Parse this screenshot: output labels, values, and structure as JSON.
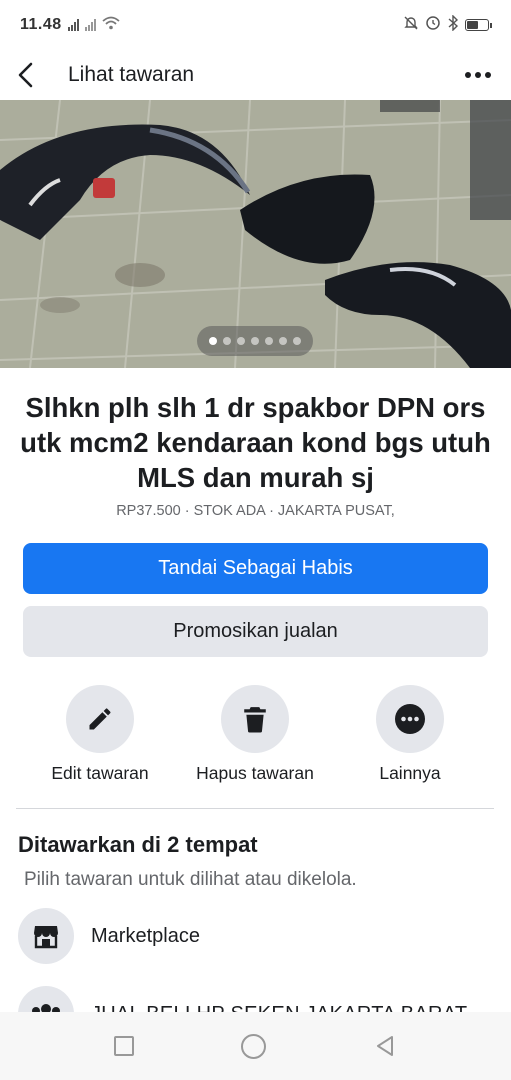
{
  "status_bar": {
    "time": "11.48",
    "icons": [
      "signal-icon",
      "signal-x-icon",
      "wifi-icon",
      "mute-icon",
      "alarm-icon",
      "bluetooth-icon",
      "battery-icon"
    ]
  },
  "header": {
    "title": "Lihat tawaran",
    "back_icon": "chevron-left-icon",
    "more_icon": "more-horizontal-icon"
  },
  "photo": {
    "carousel_count": 7,
    "active_index": 0
  },
  "listing": {
    "title": "Slhkn plh slh 1 dr spakbor DPN ors utk mcm2 kendaraan kond bgs utuh MLS dan murah sj",
    "meta": "RP37.500 · STOK ADA · JAKARTA PUSAT,"
  },
  "buttons": {
    "primary": "Tandai Sebagai Habis",
    "secondary": "Promosikan jualan"
  },
  "actions": [
    {
      "label": "Edit tawaran",
      "icon": "pencil-icon"
    },
    {
      "label": "Hapus tawaran",
      "icon": "trash-icon"
    },
    {
      "label": "Lainnya",
      "icon": "more-circle-icon"
    }
  ],
  "section": {
    "title": "Ditawarkan di 2 tempat",
    "subtitle": "Pilih tawaran untuk dilihat atau dikelola."
  },
  "places": [
    {
      "label": "Marketplace",
      "icon": "storefront-icon"
    },
    {
      "label": "JUAL BELI HP SEKEN JAKARTA BARAT",
      "icon": "group-icon"
    }
  ],
  "colors": {
    "primary": "#1877f2",
    "secondary_bg": "#e4e6eb",
    "text": "#1c1e21",
    "muted": "#65676b"
  }
}
